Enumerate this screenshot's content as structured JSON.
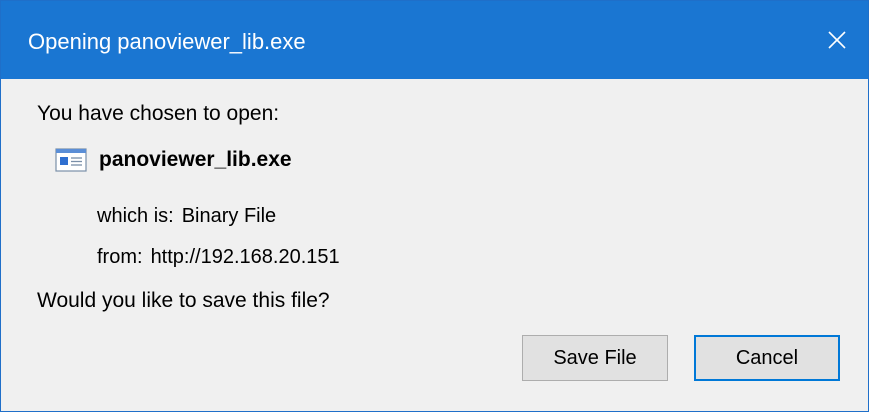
{
  "window": {
    "title": "Opening panoviewer_lib.exe",
    "close_icon": "close-icon"
  },
  "dialog": {
    "intro": "You have chosen to open:",
    "file_icon": "file-icon",
    "file_name": "panoviewer_lib.exe",
    "type_label": "which is:",
    "type_value": "Binary File",
    "from_label": "from:",
    "from_value": "http://192.168.20.151",
    "question": "Would you like to save this file?"
  },
  "buttons": {
    "save_label": "Save File",
    "cancel_label": "Cancel"
  },
  "colors": {
    "titlebar": "#1a76d2",
    "body": "#f0f0f0",
    "focus_border": "#0078d7"
  }
}
